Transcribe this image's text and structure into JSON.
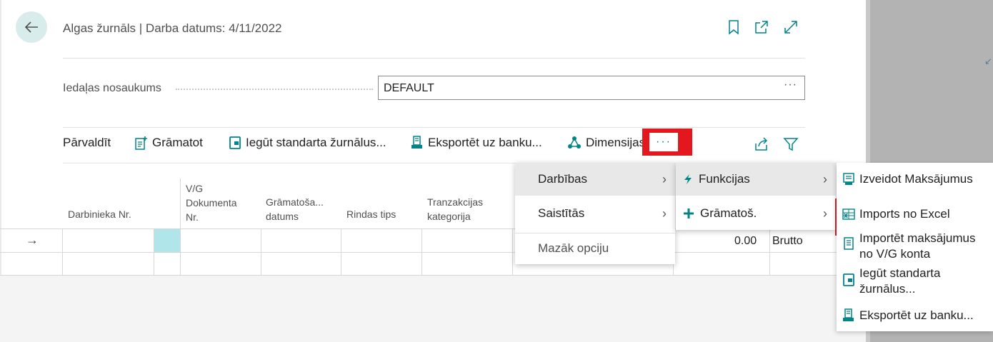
{
  "header": {
    "title": "Algas žurnāls | Darba datums: 4/11/2022",
    "icons": [
      "bookmark-icon",
      "open-new-window-icon",
      "expand-icon"
    ]
  },
  "field": {
    "label": "Iedaļas nosaukums",
    "value": "DEFAULT",
    "more": "···"
  },
  "toolbar": {
    "manage": "Pārvaldīt",
    "post": "Grāmatot",
    "get_std": "Iegūt standarta žurnālus...",
    "export": "Eksportēt uz banku...",
    "dimensions": "Dimensijas",
    "more": "···"
  },
  "columns": {
    "employee": "Darbinieka Nr.",
    "gl_doc": [
      "V/G",
      "Dokumenta",
      "Nr."
    ],
    "posting_date": [
      "Grāmatoša...",
      "datums"
    ],
    "line_type": "Rindas tips",
    "trans_cat": [
      "Tranzakcijas",
      "kategorija"
    ]
  },
  "row": {
    "arrow": "→",
    "amount": "0.00",
    "type": "Brutto"
  },
  "menu1": {
    "items": [
      "Darbības",
      "Saistītās"
    ],
    "less": "Mazāk opciju"
  },
  "menu2": {
    "items": [
      "Funkcijas",
      "Grāmatoš."
    ]
  },
  "menu3": {
    "items": [
      "Izveidot Maksājumus",
      "Imports no Excel",
      "Importēt maksājumus no V/G konta",
      "Iegūt standarta žurnālus...",
      "Eksportēt uz banku..."
    ]
  },
  "colors": {
    "accent": "#008489",
    "highlight_red": "#e3181f",
    "selected_cell": "#b0e6ea"
  }
}
